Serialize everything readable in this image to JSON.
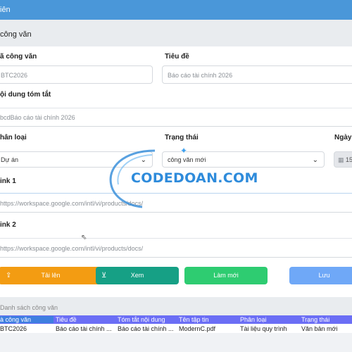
{
  "window": {
    "title": "iên"
  },
  "section": {
    "title": "công văn"
  },
  "form": {
    "code": {
      "label": "ã công văn",
      "value": "BTC2026"
    },
    "title": {
      "label": "Tiêu đề",
      "value": "Báo cáo tài chính 2026"
    },
    "summary": {
      "label": "ội dung tóm tắt",
      "value": "bcdBáo cáo tài chính 2026"
    },
    "category": {
      "label": "hân loại",
      "value": "Dự án"
    },
    "status": {
      "label": "Trạng thái",
      "value": "công văn mới"
    },
    "date": {
      "label": "Ngày",
      "value": "15"
    },
    "link1": {
      "label": "ink 1",
      "value": "https://workspace.google.com/intl/vi/products/docs/"
    },
    "link2": {
      "label": "ink 2",
      "value": "https://workspace.google.com/intl/vi/products/docs/"
    }
  },
  "buttons": {
    "upload": "Tải lên",
    "view": "Xem",
    "refresh": "Làm mới",
    "save": "Lưu"
  },
  "list": {
    "title": "Danh sách công văn",
    "columns": [
      "à công văn",
      "Tiêu đề",
      "Tóm tắt nội dung",
      "Tên tập tin",
      "Phân loại",
      "Trạng thái"
    ],
    "rows": [
      [
        "BTC2026",
        "Báo cáo tài chính ...",
        "Báo cáo tài chính ...",
        "ModernC.pdf",
        "Tài liệu quy trình",
        "Văn bản mới"
      ]
    ]
  },
  "watermark": {
    "text": "CODEDOAN.COM"
  },
  "colors": {
    "titlebar": "#4a97d9",
    "upload": "#f39c12",
    "view": "#16a085",
    "refresh": "#2ecc71",
    "save": "#6fa8f7",
    "table_header": "#6b6ef5"
  }
}
